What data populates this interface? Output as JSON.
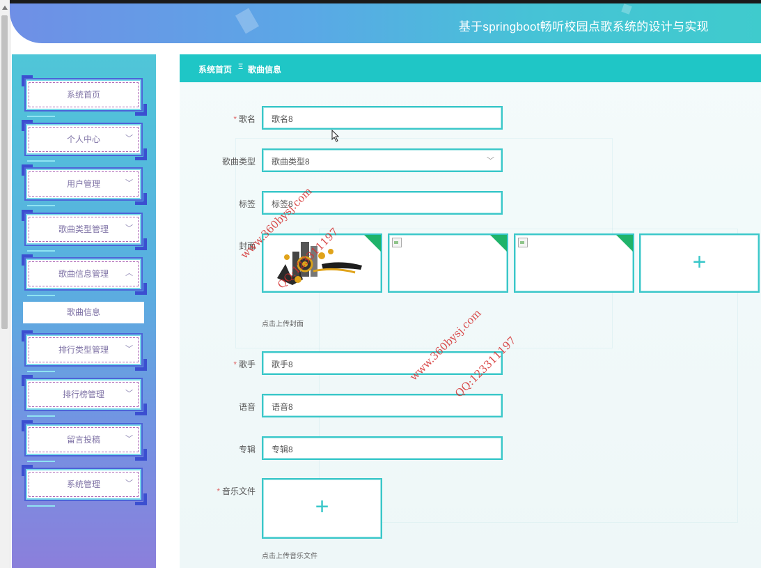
{
  "header": {
    "title": "基于springboot畅听校园点歌系统的设计与实现"
  },
  "sidebar": {
    "items": [
      {
        "label": "系统首页",
        "has_chevron": false
      },
      {
        "label": "个人中心",
        "has_chevron": true
      },
      {
        "label": "用户管理",
        "has_chevron": true
      },
      {
        "label": "歌曲类型管理",
        "has_chevron": true
      },
      {
        "label": "歌曲信息管理",
        "has_chevron": true,
        "expanded": true
      },
      {
        "label": "排行类型管理",
        "has_chevron": true
      },
      {
        "label": "排行榜管理",
        "has_chevron": true
      },
      {
        "label": "留言投稿",
        "has_chevron": true
      },
      {
        "label": "系统管理",
        "has_chevron": true
      }
    ],
    "submenu": {
      "label": "歌曲信息"
    },
    "chevron_down": "﹀",
    "chevron_up": "︿"
  },
  "breadcrumb": {
    "home": "系统首页",
    "separator": "Ξ",
    "current": "歌曲信息"
  },
  "form": {
    "song_name": {
      "label": "歌名",
      "required": true,
      "value": "歌名8"
    },
    "song_type": {
      "label": "歌曲类型",
      "required": false,
      "value": "歌曲类型8"
    },
    "tags": {
      "label": "标签",
      "required": false,
      "value": "标签8"
    },
    "cover": {
      "label": "封面",
      "required": false,
      "hint": "点击上传封面",
      "add_icon": "+"
    },
    "singer": {
      "label": "歌手",
      "required": true,
      "value": "歌手8"
    },
    "voice": {
      "label": "语音",
      "required": false,
      "value": "语音8"
    },
    "album": {
      "label": "专辑",
      "required": false,
      "value": "专辑8"
    },
    "music_file": {
      "label": "音乐文件",
      "required": true,
      "hint": "点击上传音乐文件",
      "add_icon": "+"
    }
  },
  "watermarks": [
    {
      "line1": "www.360bysj.com",
      "line2": "QQ:123311197"
    },
    {
      "line1": "www.360bysj.com",
      "line2": "QQ:123311197"
    }
  ],
  "colors": {
    "accent": "#1fc6c6",
    "required": "#e06a6a",
    "menu_border": "#4d63d8",
    "upload_flag": "#1fb36a"
  }
}
